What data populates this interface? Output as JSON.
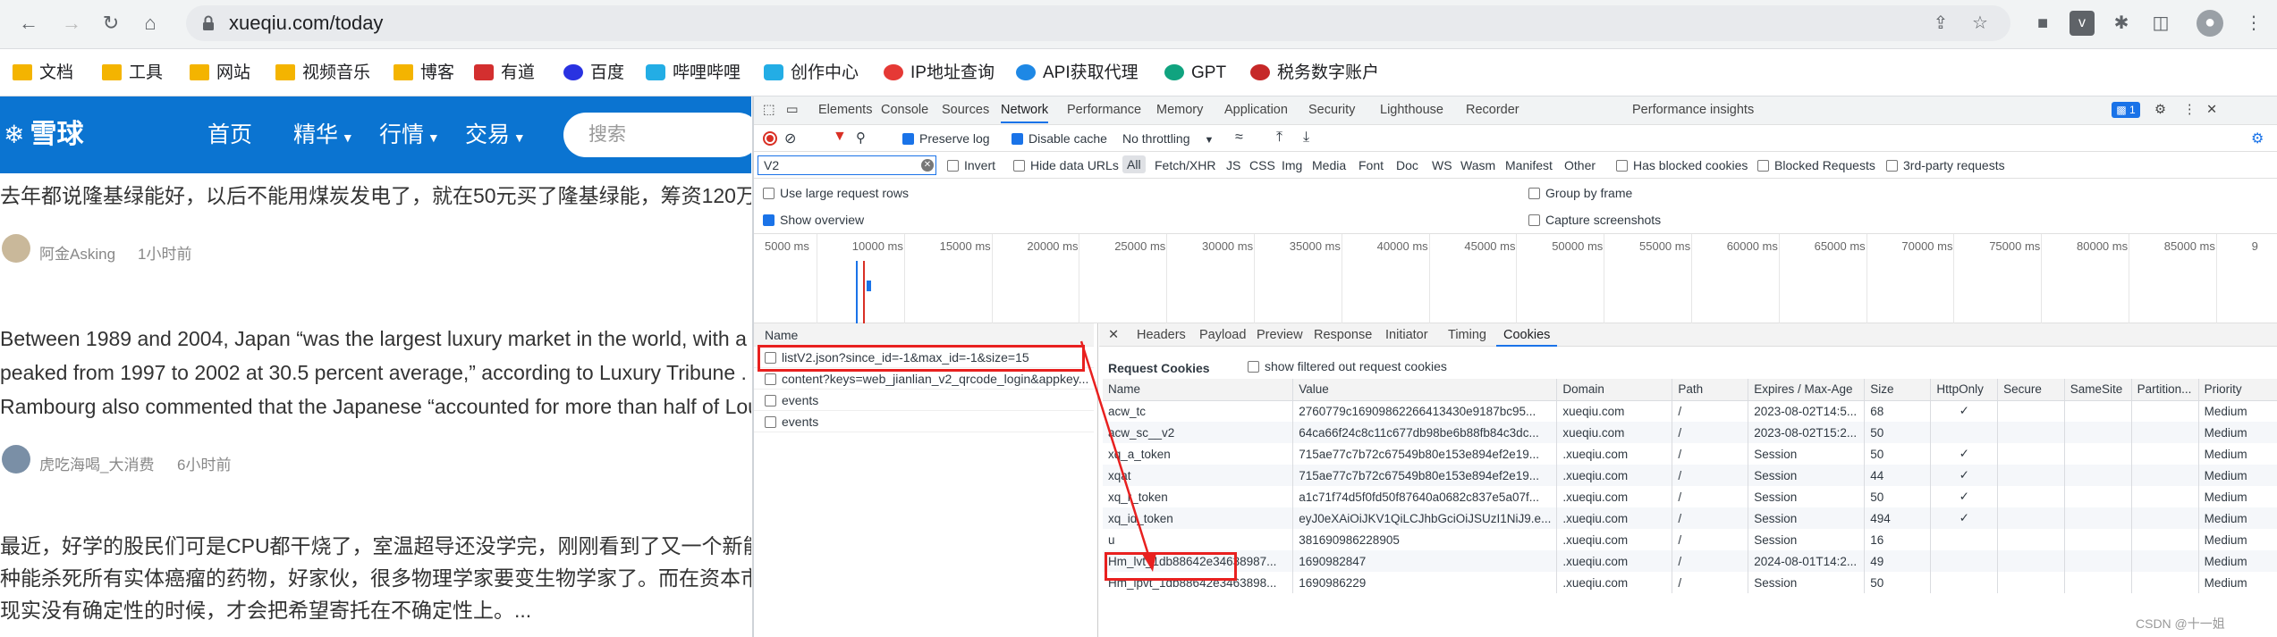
{
  "browser": {
    "url": "xueqiu.com/today",
    "bookmarks": [
      "文档",
      "工具",
      "网站",
      "视频音乐",
      "博客",
      "有道",
      "百度",
      "哔哩哔哩",
      "创作中心",
      "IP地址查询",
      "API获取代理",
      "GPT",
      "税务数字账户"
    ]
  },
  "site": {
    "logo": "雪球",
    "nav": [
      "首页",
      "精华",
      "行情",
      "交易"
    ],
    "search_placeholder": "搜索",
    "posts": [
      {
        "lines": [
          "去年都说隆基绿能好，以后不能用煤炭发电了，就在50元买了隆基绿能，筹资120万"
        ],
        "author": "阿金Asking",
        "time": "1小时前"
      },
      {
        "lines": [
          "Between 1989 and 2004, Japan “was the largest luxury market in the world, with a",
          "peaked from 1997 to 2002 at 30.5 percent average,” according to Luxury Tribune .",
          "Rambourg also commented that the Japanese “accounted for more than half of Lou"
        ],
        "author": "虎吃海喝_大消费",
        "time": "6小时前"
      },
      {
        "lines": [
          "最近，好学的股民们可是CPU都干烧了，室温超导还没学完，刚刚看到了又一个新能",
          "种能杀死所有实体癌瘤的药物，好家伙，很多物理学家要变生物学家了。而在资本市",
          "现实没有确定性的时候，才会把希望寄托在不确定性上。..."
        ],
        "author": "",
        "time": ""
      }
    ]
  },
  "devtools": {
    "tabs": [
      "Elements",
      "Console",
      "Sources",
      "Network",
      "Performance",
      "Memory",
      "Application",
      "Security",
      "Lighthouse",
      "Recorder",
      "Performance insights"
    ],
    "badge": "1",
    "toolbar": {
      "preserve_log": "Preserve log",
      "disable_cache": "Disable cache",
      "throttling": "No throttling"
    },
    "filter": {
      "value": "V2",
      "invert": "Invert",
      "hide_data_urls": "Hide data URLs",
      "types": [
        "All",
        "Fetch/XHR",
        "JS",
        "CSS",
        "Img",
        "Media",
        "Font",
        "Doc",
        "WS",
        "Wasm",
        "Manifest",
        "Other"
      ],
      "has_blocked": "Has blocked cookies",
      "blocked_requests": "Blocked Requests",
      "third_party": "3rd-party requests"
    },
    "options": {
      "large_rows": "Use large request rows",
      "group_by_frame": "Group by frame",
      "show_overview": "Show overview",
      "capture_screenshots": "Capture screenshots"
    },
    "timeline_ticks": [
      "5000 ms",
      "10000 ms",
      "15000 ms",
      "20000 ms",
      "25000 ms",
      "30000 ms",
      "35000 ms",
      "40000 ms",
      "45000 ms",
      "50000 ms",
      "55000 ms",
      "60000 ms",
      "65000 ms",
      "70000 ms",
      "75000 ms",
      "80000 ms",
      "85000 ms",
      "9"
    ],
    "requests": {
      "header": "Name",
      "items": [
        "listV2.json?since_id=-1&max_id=-1&size=15",
        "content?keys=web_jianlian_v2_qrcode_login&appkey...",
        "events",
        "events"
      ]
    },
    "detail_tabs": [
      "Headers",
      "Payload",
      "Preview",
      "Response",
      "Initiator",
      "Timing",
      "Cookies"
    ],
    "cookies": {
      "title": "Request Cookies",
      "show_filtered": "show filtered out request cookies",
      "columns": [
        "Name",
        "Value",
        "Domain",
        "Path",
        "Expires / Max-Age",
        "Size",
        "HttpOnly",
        "Secure",
        "SameSite",
        "Partition...",
        "Priority"
      ],
      "rows": [
        [
          "acw_tc",
          "2760779c16909862266413430e9187bc95...",
          "xueqiu.com",
          "/",
          "2023-08-02T14:5...",
          "68",
          "✓",
          "",
          "",
          "",
          "Medium"
        ],
        [
          "acw_sc__v2",
          "64ca66f24c8c11c677db98be6b88fb84c3dc...",
          "xueqiu.com",
          "/",
          "2023-08-02T15:2...",
          "50",
          "",
          "",
          "",
          "",
          "Medium"
        ],
        [
          "xq_a_token",
          "715ae77c7b72c67549b80e153e894ef2e19...",
          ".xueqiu.com",
          "/",
          "Session",
          "50",
          "✓",
          "",
          "",
          "",
          "Medium"
        ],
        [
          "xqat",
          "715ae77c7b72c67549b80e153e894ef2e19...",
          ".xueqiu.com",
          "/",
          "Session",
          "44",
          "✓",
          "",
          "",
          "",
          "Medium"
        ],
        [
          "xq_r_token",
          "a1c71f74d5f0fd50f87640a0682c837e5a07f...",
          ".xueqiu.com",
          "/",
          "Session",
          "50",
          "✓",
          "",
          "",
          "",
          "Medium"
        ],
        [
          "xq_id_token",
          "eyJ0eXAiOiJKV1QiLCJhbGciOiJSUzI1NiJ9.e...",
          ".xueqiu.com",
          "/",
          "Session",
          "494",
          "✓",
          "",
          "",
          "",
          "Medium"
        ],
        [
          "u",
          "381690986228905",
          ".xueqiu.com",
          "/",
          "Session",
          "16",
          "",
          "",
          "",
          "",
          "Medium"
        ],
        [
          "Hm_lvt_1db88642e34638987...",
          "1690982847",
          ".xueqiu.com",
          "/",
          "2024-08-01T14:2...",
          "49",
          "",
          "",
          "",
          "",
          "Medium"
        ],
        [
          "Hm_lpvt_1db88642e3463898...",
          "1690986229",
          ".xueqiu.com",
          "/",
          "Session",
          "50",
          "",
          "",
          "",
          "",
          "Medium"
        ]
      ]
    }
  },
  "watermark": "CSDN @十一姐"
}
